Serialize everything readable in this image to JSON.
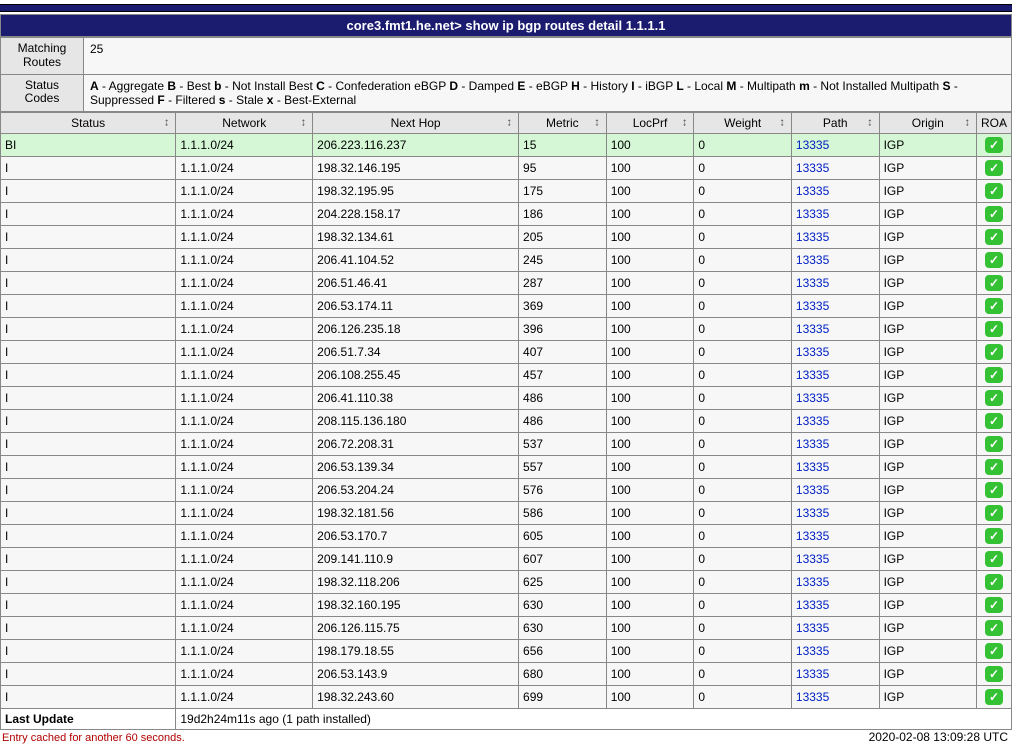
{
  "title": "core3.fmt1.he.net> show ip bgp routes detail 1.1.1.1",
  "matching_routes": {
    "label": "Matching\nRoutes",
    "value": "25"
  },
  "status_codes": {
    "label": "Status\nCodes",
    "codes": [
      {
        "k": "A",
        "v": "Aggregate"
      },
      {
        "k": "B",
        "v": "Best"
      },
      {
        "k": "b",
        "v": "Not Install Best"
      },
      {
        "k": "C",
        "v": "Confederation eBGP"
      },
      {
        "k": "D",
        "v": "Damped"
      },
      {
        "k": "E",
        "v": "eBGP"
      },
      {
        "k": "H",
        "v": "History"
      },
      {
        "k": "I",
        "v": "iBGP"
      },
      {
        "k": "L",
        "v": "Local"
      },
      {
        "k": "M",
        "v": "Multipath"
      },
      {
        "k": "m",
        "v": "Not Installed Multipath"
      },
      {
        "k": "S",
        "v": "Suppressed"
      },
      {
        "k": "F",
        "v": "Filtered"
      },
      {
        "k": "s",
        "v": "Stale"
      },
      {
        "k": "x",
        "v": "Best-External"
      }
    ]
  },
  "columns": [
    "Status",
    "Network",
    "Next Hop",
    "Metric",
    "LocPrf",
    "Weight",
    "Path",
    "Origin",
    "ROA"
  ],
  "col_widths": [
    "170px",
    "130px",
    "200px",
    "80px",
    "80px",
    "90px",
    "80px",
    "90px",
    ""
  ],
  "rows": [
    {
      "best": true,
      "status": "BI",
      "network": "1.1.1.0/24",
      "nexthop": "206.223.116.237",
      "metric": "15",
      "locprf": "100",
      "weight": "0",
      "path": "13335",
      "origin": "IGP",
      "roa": "valid"
    },
    {
      "status": "I",
      "network": "1.1.1.0/24",
      "nexthop": "198.32.146.195",
      "metric": "95",
      "locprf": "100",
      "weight": "0",
      "path": "13335",
      "origin": "IGP",
      "roa": "valid"
    },
    {
      "status": "I",
      "network": "1.1.1.0/24",
      "nexthop": "198.32.195.95",
      "metric": "175",
      "locprf": "100",
      "weight": "0",
      "path": "13335",
      "origin": "IGP",
      "roa": "valid"
    },
    {
      "status": "I",
      "network": "1.1.1.0/24",
      "nexthop": "204.228.158.17",
      "metric": "186",
      "locprf": "100",
      "weight": "0",
      "path": "13335",
      "origin": "IGP",
      "roa": "valid"
    },
    {
      "status": "I",
      "network": "1.1.1.0/24",
      "nexthop": "198.32.134.61",
      "metric": "205",
      "locprf": "100",
      "weight": "0",
      "path": "13335",
      "origin": "IGP",
      "roa": "valid"
    },
    {
      "status": "I",
      "network": "1.1.1.0/24",
      "nexthop": "206.41.104.52",
      "metric": "245",
      "locprf": "100",
      "weight": "0",
      "path": "13335",
      "origin": "IGP",
      "roa": "valid"
    },
    {
      "status": "I",
      "network": "1.1.1.0/24",
      "nexthop": "206.51.46.41",
      "metric": "287",
      "locprf": "100",
      "weight": "0",
      "path": "13335",
      "origin": "IGP",
      "roa": "valid"
    },
    {
      "status": "I",
      "network": "1.1.1.0/24",
      "nexthop": "206.53.174.11",
      "metric": "369",
      "locprf": "100",
      "weight": "0",
      "path": "13335",
      "origin": "IGP",
      "roa": "valid"
    },
    {
      "status": "I",
      "network": "1.1.1.0/24",
      "nexthop": "206.126.235.18",
      "metric": "396",
      "locprf": "100",
      "weight": "0",
      "path": "13335",
      "origin": "IGP",
      "roa": "valid"
    },
    {
      "status": "I",
      "network": "1.1.1.0/24",
      "nexthop": "206.51.7.34",
      "metric": "407",
      "locprf": "100",
      "weight": "0",
      "path": "13335",
      "origin": "IGP",
      "roa": "valid"
    },
    {
      "status": "I",
      "network": "1.1.1.0/24",
      "nexthop": "206.108.255.45",
      "metric": "457",
      "locprf": "100",
      "weight": "0",
      "path": "13335",
      "origin": "IGP",
      "roa": "valid"
    },
    {
      "status": "I",
      "network": "1.1.1.0/24",
      "nexthop": "206.41.110.38",
      "metric": "486",
      "locprf": "100",
      "weight": "0",
      "path": "13335",
      "origin": "IGP",
      "roa": "valid"
    },
    {
      "status": "I",
      "network": "1.1.1.0/24",
      "nexthop": "208.115.136.180",
      "metric": "486",
      "locprf": "100",
      "weight": "0",
      "path": "13335",
      "origin": "IGP",
      "roa": "valid"
    },
    {
      "status": "I",
      "network": "1.1.1.0/24",
      "nexthop": "206.72.208.31",
      "metric": "537",
      "locprf": "100",
      "weight": "0",
      "path": "13335",
      "origin": "IGP",
      "roa": "valid"
    },
    {
      "status": "I",
      "network": "1.1.1.0/24",
      "nexthop": "206.53.139.34",
      "metric": "557",
      "locprf": "100",
      "weight": "0",
      "path": "13335",
      "origin": "IGP",
      "roa": "valid"
    },
    {
      "status": "I",
      "network": "1.1.1.0/24",
      "nexthop": "206.53.204.24",
      "metric": "576",
      "locprf": "100",
      "weight": "0",
      "path": "13335",
      "origin": "IGP",
      "roa": "valid"
    },
    {
      "status": "I",
      "network": "1.1.1.0/24",
      "nexthop": "198.32.181.56",
      "metric": "586",
      "locprf": "100",
      "weight": "0",
      "path": "13335",
      "origin": "IGP",
      "roa": "valid"
    },
    {
      "status": "I",
      "network": "1.1.1.0/24",
      "nexthop": "206.53.170.7",
      "metric": "605",
      "locprf": "100",
      "weight": "0",
      "path": "13335",
      "origin": "IGP",
      "roa": "valid"
    },
    {
      "status": "I",
      "network": "1.1.1.0/24",
      "nexthop": "209.141.110.9",
      "metric": "607",
      "locprf": "100",
      "weight": "0",
      "path": "13335",
      "origin": "IGP",
      "roa": "valid"
    },
    {
      "status": "I",
      "network": "1.1.1.0/24",
      "nexthop": "198.32.118.206",
      "metric": "625",
      "locprf": "100",
      "weight": "0",
      "path": "13335",
      "origin": "IGP",
      "roa": "valid"
    },
    {
      "status": "I",
      "network": "1.1.1.0/24",
      "nexthop": "198.32.160.195",
      "metric": "630",
      "locprf": "100",
      "weight": "0",
      "path": "13335",
      "origin": "IGP",
      "roa": "valid"
    },
    {
      "status": "I",
      "network": "1.1.1.0/24",
      "nexthop": "206.126.115.75",
      "metric": "630",
      "locprf": "100",
      "weight": "0",
      "path": "13335",
      "origin": "IGP",
      "roa": "valid"
    },
    {
      "status": "I",
      "network": "1.1.1.0/24",
      "nexthop": "198.179.18.55",
      "metric": "656",
      "locprf": "100",
      "weight": "0",
      "path": "13335",
      "origin": "IGP",
      "roa": "valid"
    },
    {
      "status": "I",
      "network": "1.1.1.0/24",
      "nexthop": "206.53.143.9",
      "metric": "680",
      "locprf": "100",
      "weight": "0",
      "path": "13335",
      "origin": "IGP",
      "roa": "valid"
    },
    {
      "status": "I",
      "network": "1.1.1.0/24",
      "nexthop": "198.32.243.60",
      "metric": "699",
      "locprf": "100",
      "weight": "0",
      "path": "13335",
      "origin": "IGP",
      "roa": "valid"
    }
  ],
  "last_update": {
    "label": "Last Update",
    "value": "19d2h24m11s ago (1 path installed)"
  },
  "cache_note": "Entry cached for another 60 seconds.",
  "timestamp": "2020-02-08 13:09:28 UTC",
  "roa_glyph": "✓"
}
